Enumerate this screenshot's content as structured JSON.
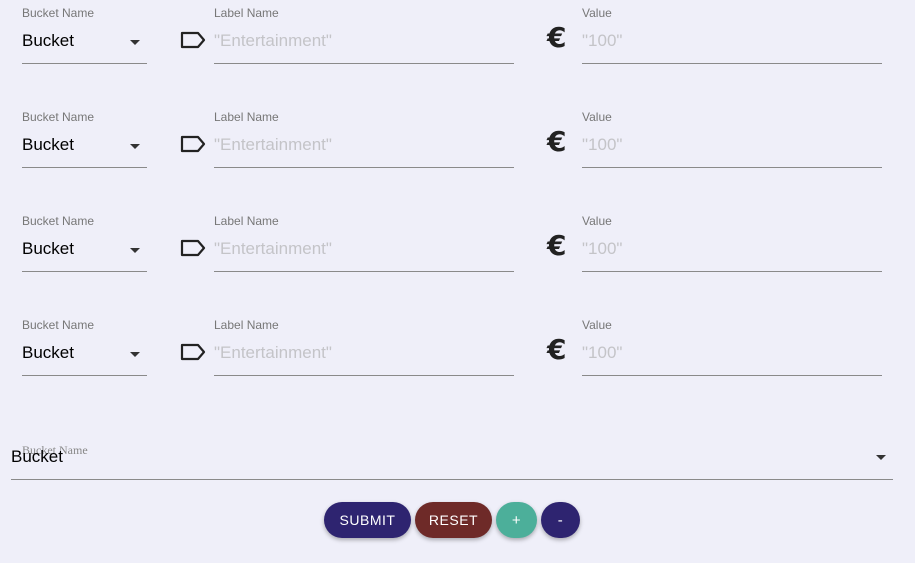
{
  "rows": [
    {
      "bucket_label": "Bucket Name",
      "bucket_value": "Bucket",
      "label_label": "Label Name",
      "label_placeholder": "\"Entertainment\"",
      "value_label": "Value",
      "value_placeholder": "\"100\""
    },
    {
      "bucket_label": "Bucket Name",
      "bucket_value": "Bucket",
      "label_label": "Label Name",
      "label_placeholder": "\"Entertainment\"",
      "value_label": "Value",
      "value_placeholder": "\"100\""
    },
    {
      "bucket_label": "Bucket Name",
      "bucket_value": "Bucket",
      "label_label": "Label Name",
      "label_placeholder": "\"Entertainment\"",
      "value_label": "Value",
      "value_placeholder": "\"100\""
    },
    {
      "bucket_label": "Bucket Name",
      "bucket_value": "Bucket",
      "label_label": "Label Name",
      "label_placeholder": "\"Entertainment\"",
      "value_label": "Value",
      "value_placeholder": "\"100\""
    }
  ],
  "wide_bucket": {
    "label": "Bucket Name",
    "value": "Bucket"
  },
  "buttons": {
    "submit": "SUBMIT",
    "reset": "RESET",
    "add": "+",
    "remove": "-"
  },
  "icons": {
    "label": "tag-icon",
    "value": "euro-icon"
  },
  "colors": {
    "submit": "#2e2470",
    "reset": "#6e2a28",
    "add": "#4caf9a",
    "remove": "#2e2470",
    "background": "#efeff9"
  }
}
